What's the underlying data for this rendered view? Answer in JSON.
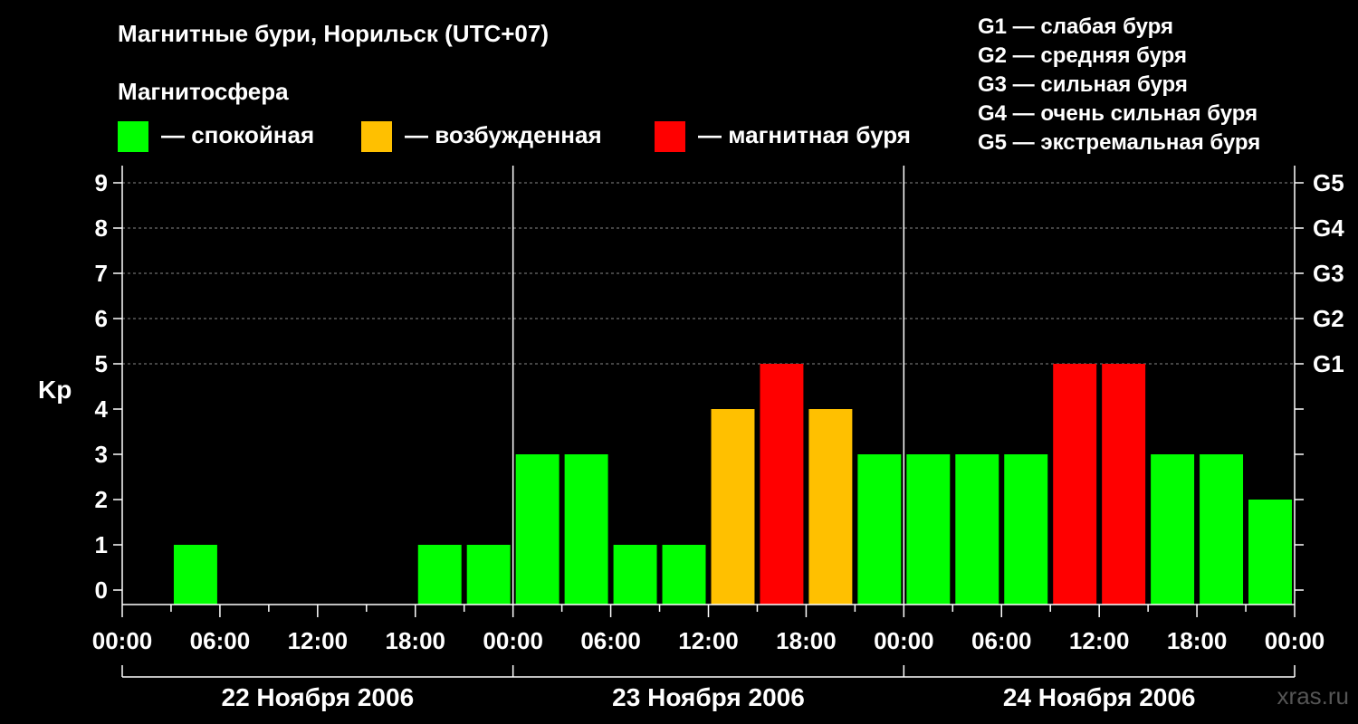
{
  "title": "Магнитные бури, Норильск (UTC+07)",
  "legend": {
    "heading": "Магнитосфера",
    "items": [
      {
        "label": "— спокойная",
        "color": "#00ff00"
      },
      {
        "label": "— возбужденная",
        "color": "#ffc000"
      },
      {
        "label": "— магнитная буря",
        "color": "#ff0000"
      }
    ]
  },
  "g_scale": [
    "G1 — слабая буря",
    "G2 — средняя буря",
    "G3 — сильная буря",
    "G4 — очень сильная буря",
    "G5 — экстремальная буря"
  ],
  "watermark": "xras.ru",
  "chart_data": {
    "type": "bar",
    "ylabel": "Kp",
    "ylim": [
      0,
      9
    ],
    "y_ticks": [
      "0",
      "1",
      "2",
      "3",
      "4",
      "5",
      "6",
      "7",
      "8",
      "9"
    ],
    "right_ticks": [
      {
        "kp": 5,
        "label": "G1"
      },
      {
        "kp": 6,
        "label": "G2"
      },
      {
        "kp": 7,
        "label": "G3"
      },
      {
        "kp": 8,
        "label": "G4"
      },
      {
        "kp": 9,
        "label": "G5"
      }
    ],
    "x_tick_labels": [
      "00:00",
      "06:00",
      "12:00",
      "18:00",
      "00:00",
      "06:00",
      "12:00",
      "18:00",
      "00:00",
      "06:00",
      "12:00",
      "18:00",
      "00:00"
    ],
    "days": [
      "22 Ноября 2006",
      "23 Ноября 2006",
      "24 Ноября 2006"
    ],
    "grid": "dashed horizontal",
    "colors": {
      "quiet": "#00ff00",
      "active": "#ffc000",
      "storm": "#ff0000"
    },
    "bars": [
      {
        "start_hour": 3,
        "kp": 1,
        "status": "quiet"
      },
      {
        "start_hour": 18,
        "kp": 1,
        "status": "quiet"
      },
      {
        "start_hour": 21,
        "kp": 1,
        "status": "quiet"
      },
      {
        "start_hour": 24,
        "kp": 3,
        "status": "quiet"
      },
      {
        "start_hour": 27,
        "kp": 3,
        "status": "quiet"
      },
      {
        "start_hour": 30,
        "kp": 1,
        "status": "quiet"
      },
      {
        "start_hour": 33,
        "kp": 1,
        "status": "quiet"
      },
      {
        "start_hour": 36,
        "kp": 4,
        "status": "active"
      },
      {
        "start_hour": 39,
        "kp": 5,
        "status": "storm"
      },
      {
        "start_hour": 42,
        "kp": 4,
        "status": "active"
      },
      {
        "start_hour": 45,
        "kp": 3,
        "status": "quiet"
      },
      {
        "start_hour": 48,
        "kp": 3,
        "status": "quiet"
      },
      {
        "start_hour": 51,
        "kp": 3,
        "status": "quiet"
      },
      {
        "start_hour": 54,
        "kp": 3,
        "status": "quiet"
      },
      {
        "start_hour": 57,
        "kp": 5,
        "status": "storm"
      },
      {
        "start_hour": 60,
        "kp": 5,
        "status": "storm"
      },
      {
        "start_hour": 63,
        "kp": 3,
        "status": "quiet"
      },
      {
        "start_hour": 66,
        "kp": 3,
        "status": "quiet"
      },
      {
        "start_hour": 69,
        "kp": 2,
        "status": "quiet"
      }
    ]
  }
}
